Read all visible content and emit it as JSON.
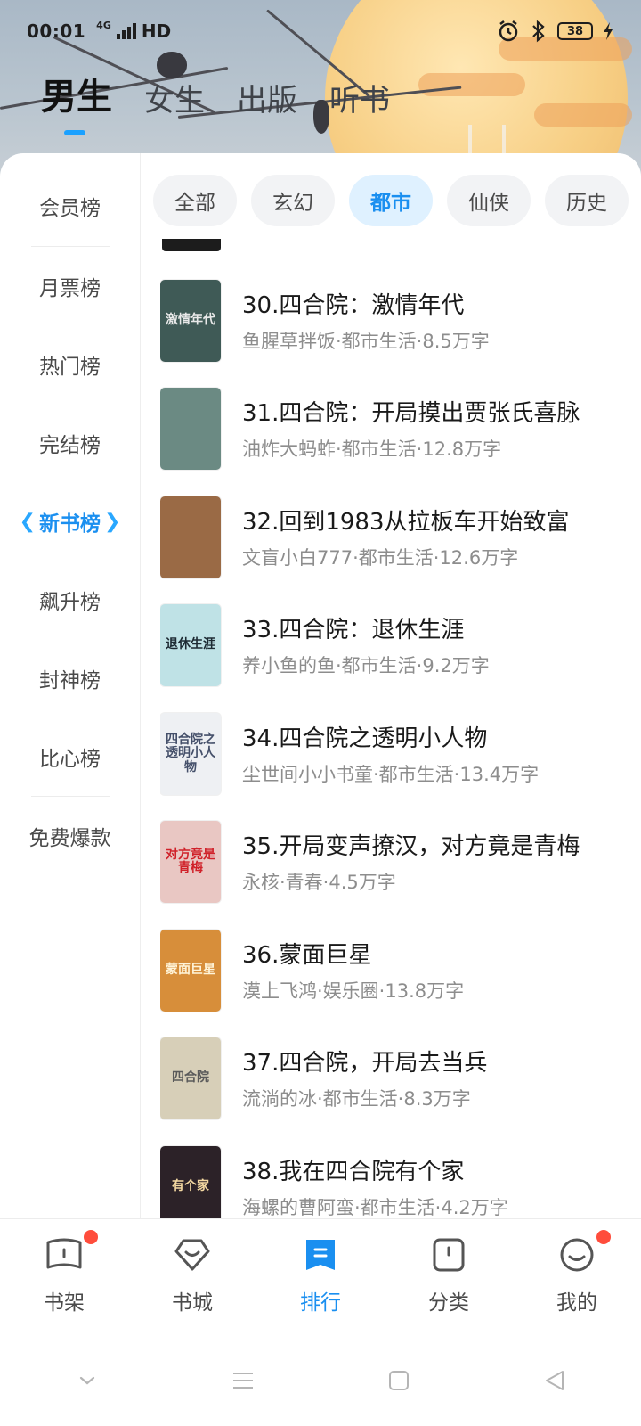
{
  "status_bar": {
    "time": "00:01",
    "network": "HD",
    "network_small": "4G",
    "battery": "38"
  },
  "gender_tabs": [
    {
      "label": "男生",
      "active": true
    },
    {
      "label": "女生",
      "active": false
    },
    {
      "label": "出版",
      "active": false
    },
    {
      "label": "听书",
      "active": false
    }
  ],
  "sidebar": {
    "items": [
      {
        "label": "会员榜"
      },
      {
        "label": "月票榜"
      },
      {
        "label": "热门榜"
      },
      {
        "label": "完结榜"
      },
      {
        "label": "新书榜",
        "active": true
      },
      {
        "label": "飙升榜"
      },
      {
        "label": "封神榜"
      },
      {
        "label": "比心榜"
      },
      {
        "label": "免费爆款"
      }
    ]
  },
  "filters": [
    {
      "label": "全部"
    },
    {
      "label": "玄幻"
    },
    {
      "label": "都市",
      "active": true
    },
    {
      "label": "仙侠"
    },
    {
      "label": "历史"
    }
  ],
  "books": [
    {
      "title": "30.四合院：激情年代",
      "meta": "鱼腥草拌饭·都市生活·8.5万字",
      "cover_text": "激情年代",
      "cover_color": "#3f5a56",
      "cover_text_color": "#e8e8e8"
    },
    {
      "title": "31.四合院：开局摸出贾张氏喜脉",
      "meta": "油炸大蚂蚱·都市生活·12.8万字",
      "cover_text": "",
      "cover_color": "#6b8a83",
      "cover_text_color": "#ffffff"
    },
    {
      "title": "32.回到1983从拉板车开始致富",
      "meta": "文盲小白777·都市生活·12.6万字",
      "cover_text": "",
      "cover_color": "#9a6a45",
      "cover_text_color": "#ffffff"
    },
    {
      "title": "33.四合院：退休生涯",
      "meta": "养小鱼的鱼·都市生活·9.2万字",
      "cover_text": "退休生涯",
      "cover_color": "#bfe2e6",
      "cover_text_color": "#1d2a33"
    },
    {
      "title": "34.四合院之透明小人物",
      "meta": "尘世间小小书童·都市生活·13.4万字",
      "cover_text": "四合院之透明小人物",
      "cover_color": "#eef0f3",
      "cover_text_color": "#45506a"
    },
    {
      "title": "35.开局变声撩汉，对方竟是青梅",
      "meta": "永核·青春·4.5万字",
      "cover_text": "对方竟是青梅",
      "cover_color": "#e9c7c3",
      "cover_text_color": "#d0222a"
    },
    {
      "title": "36.蒙面巨星",
      "meta": "漠上飞鸿·娱乐圈·13.8万字",
      "cover_text": "蒙面巨星",
      "cover_color": "#d78e3a",
      "cover_text_color": "#fff4d8"
    },
    {
      "title": "37.四合院，开局去当兵",
      "meta": "流淌的冰·都市生活·8.3万字",
      "cover_text": "四合院",
      "cover_color": "#d7cfb8",
      "cover_text_color": "#5b5b5b"
    },
    {
      "title": "38.我在四合院有个家",
      "meta": "海螺的曹阿蛮·都市生活·4.2万字",
      "cover_text": "有个家",
      "cover_color": "#2c2228",
      "cover_text_color": "#f4d9a2"
    }
  ],
  "bottom_nav": [
    {
      "label": "书架",
      "icon": "book-icon",
      "badge": true
    },
    {
      "label": "书城",
      "icon": "heart-icon",
      "badge": false
    },
    {
      "label": "排行",
      "icon": "rank-icon",
      "active": true,
      "badge": false
    },
    {
      "label": "分类",
      "icon": "category-icon",
      "badge": false
    },
    {
      "label": "我的",
      "icon": "profile-icon",
      "badge": true
    }
  ],
  "colors": {
    "accent": "#1a8ff0",
    "badge": "#ff4d3c"
  }
}
